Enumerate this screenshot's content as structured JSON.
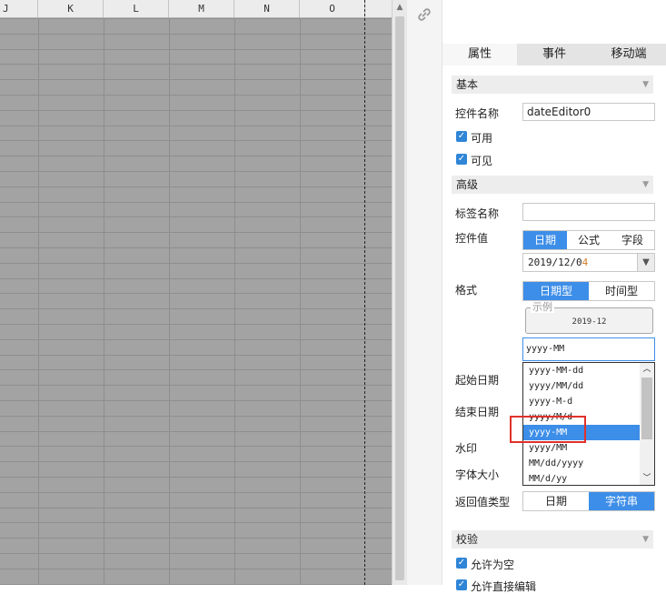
{
  "sheet": {
    "columns": [
      "J",
      "K",
      "L",
      "M",
      "N",
      "O"
    ]
  },
  "panel": {
    "tabs": [
      {
        "label": "属性",
        "active": true
      },
      {
        "label": "事件",
        "active": false
      },
      {
        "label": "移动端",
        "active": false
      }
    ],
    "basic": {
      "section_title": "基本",
      "control_name_label": "控件名称",
      "control_name_value": "dateEditor0",
      "enabled_label": "可用",
      "enabled_checked": true,
      "visible_label": "可见",
      "visible_checked": true
    },
    "advanced": {
      "section_title": "高级",
      "tag_name_label": "标签名称",
      "tag_name_value": "",
      "control_value_label": "控件值",
      "value_options": [
        "日期",
        "公式",
        "字段"
      ],
      "value_selected": "日期",
      "date_value_main": "2019/12/0",
      "date_value_cursor": "4",
      "format_label": "格式",
      "format_type_options": [
        "日期型",
        "时间型"
      ],
      "format_type_selected": "日期型",
      "sample_legend": "示例",
      "sample_value": "2019-12",
      "format_input_value": "yyyy-MM",
      "format_options": [
        "yyyy-MM-dd",
        "yyyy/MM/dd",
        "yyyy-M-d",
        "yyyy/M/d",
        "yyyy-MM",
        "yyyy/MM",
        "MM/dd/yyyy",
        "MM/d/yy"
      ],
      "format_selected": "yyyy-MM",
      "start_date_label": "起始日期",
      "end_date_label": "结束日期",
      "watermark_label": "水印",
      "font_size_label": "字体大小",
      "return_type_label": "返回值类型",
      "return_type_options": [
        "日期",
        "字符串"
      ],
      "return_type_selected": "字符串"
    },
    "validation": {
      "section_title": "校验",
      "allow_empty_label": "允许为空",
      "allow_empty_checked": true,
      "allow_direct_edit_label": "允许直接编辑",
      "allow_direct_edit_checked": true
    }
  },
  "colors": {
    "accent": "#3d8ee8",
    "checkbox": "#2f85d6",
    "highlight": "#e0312b",
    "sheet_bg": "#a3a3a3"
  },
  "icons": {
    "link": "link-icon",
    "section_caret": "chevron-down-icon",
    "select_caret": "chevron-down-icon",
    "check": "check-icon"
  }
}
